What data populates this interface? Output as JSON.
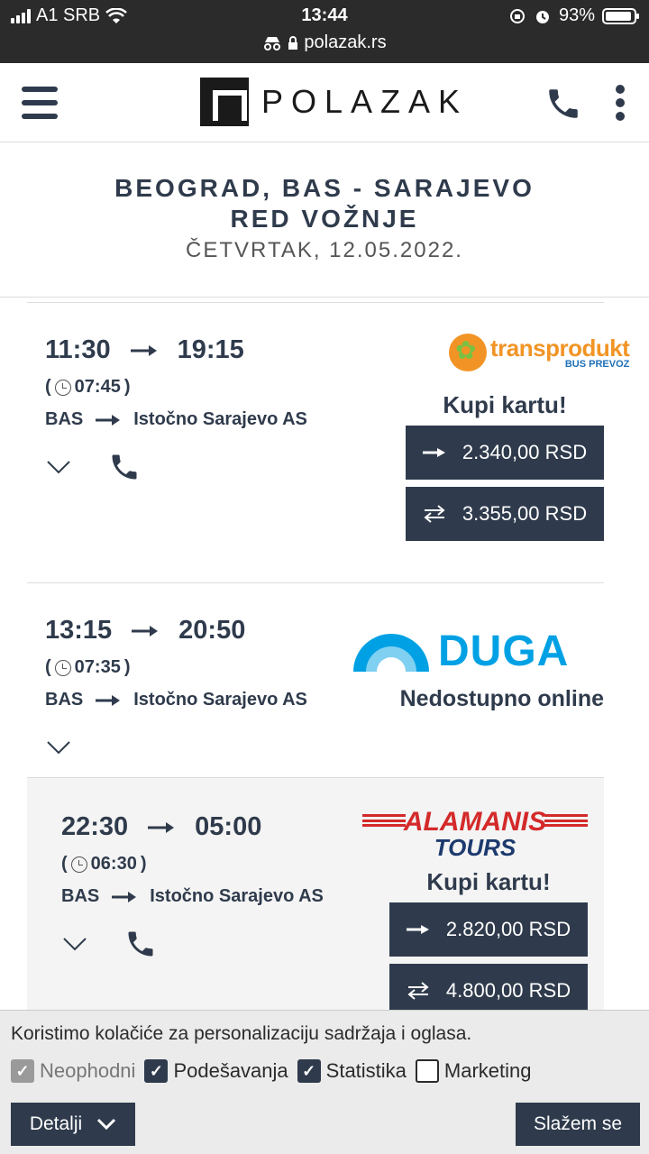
{
  "status_bar": {
    "carrier": "A1 SRB",
    "time": "13:44",
    "battery": "93%",
    "battery_level": 0.93,
    "url": "polazak.rs"
  },
  "header": {
    "logo_text": "POLAZAK"
  },
  "page": {
    "title": "BEOGRAD, BAS - SARAJEVO RED VOŽNJE",
    "date": "ČETVRTAK, 12.05.2022."
  },
  "departures": [
    {
      "depart": "11:30",
      "arrive": "19:15",
      "duration": "07:45",
      "from": "BAS",
      "to": "Istočno Sarajevo AS",
      "operator": {
        "name": "transprodukt",
        "sub": "BUS PREVOZ"
      },
      "buy_label": "Kupi kartu!",
      "prices": [
        {
          "type": "one-way",
          "value": "2.340,00 RSD"
        },
        {
          "type": "return",
          "value": "3.355,00 RSD"
        }
      ]
    },
    {
      "depart": "13:15",
      "arrive": "20:50",
      "duration": "07:35",
      "from": "BAS",
      "to": "Istočno Sarajevo AS",
      "operator": {
        "name": "DUGA"
      },
      "status": "Nedostupno online"
    },
    {
      "depart": "22:30",
      "arrive": "05:00",
      "duration": "06:30",
      "from": "BAS",
      "to": "Istočno Sarajevo AS",
      "operator": {
        "name": "ALAMANIS",
        "sub": "TOURS"
      },
      "buy_label": "Kupi kartu!",
      "prices": [
        {
          "type": "one-way",
          "value": "2.820,00 RSD"
        },
        {
          "type": "return",
          "value": "4.800,00 RSD"
        }
      ]
    }
  ],
  "cookie": {
    "text": "Koristimo kolačiće za personalizaciju sadržaja i oglasa.",
    "options": [
      {
        "label": "Neophodni",
        "checked": true,
        "disabled": true
      },
      {
        "label": "Podešavanja",
        "checked": true
      },
      {
        "label": "Statistika",
        "checked": true
      },
      {
        "label": "Marketing",
        "checked": false
      }
    ],
    "details_label": "Detalji",
    "accept_label": "Slažem se"
  },
  "colors": {
    "primary": "#2f3b4c",
    "status_bar": "#2b2b2b",
    "transprodukt_orange": "#f29425",
    "duga_blue": "#00a1e4",
    "alamanis_red": "#d42a2a"
  },
  "icons": [
    "signal-icon",
    "wifi-icon",
    "incognito-icon",
    "lock-icon",
    "rotation-lock-icon",
    "alarm-icon",
    "battery-icon",
    "menu-icon",
    "phone-icon",
    "more-vertical-icon",
    "arrow-right-icon",
    "clock-icon",
    "chevron-down-icon",
    "swap-arrows-icon",
    "check-icon"
  ]
}
